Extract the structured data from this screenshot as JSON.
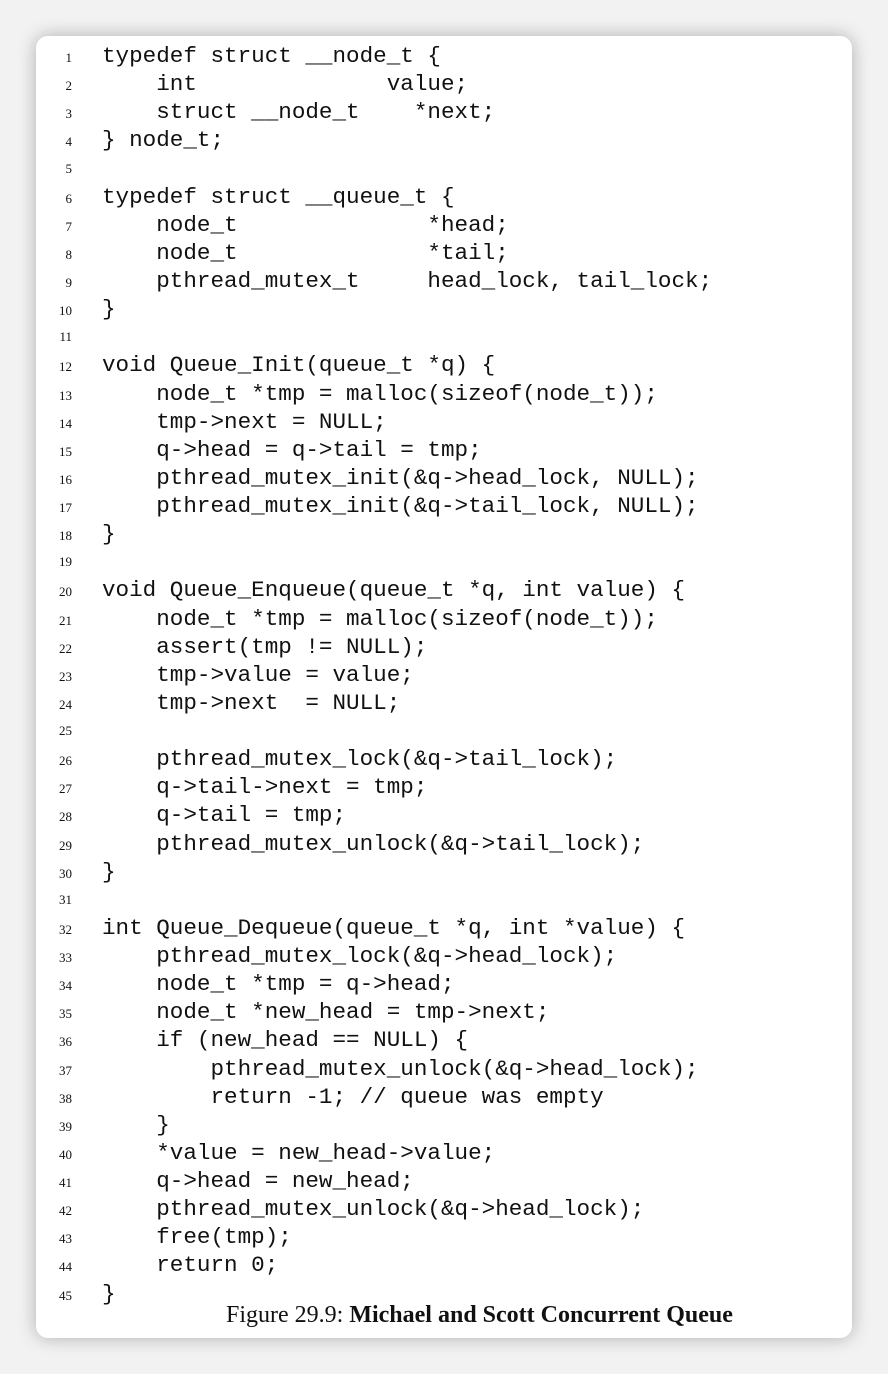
{
  "code_lines": [
    {
      "number": "1",
      "code": "typedef struct __node_t {"
    },
    {
      "number": "2",
      "code": "    int              value;"
    },
    {
      "number": "3",
      "code": "    struct __node_t    *next;"
    },
    {
      "number": "4",
      "code": "} node_t;"
    },
    {
      "number": "5",
      "code": ""
    },
    {
      "number": "6",
      "code": "typedef struct __queue_t {"
    },
    {
      "number": "7",
      "code": "    node_t              *head;"
    },
    {
      "number": "8",
      "code": "    node_t              *tail;"
    },
    {
      "number": "9",
      "code": "    pthread_mutex_t     head_lock, tail_lock;"
    },
    {
      "number": "10",
      "code": "}"
    },
    {
      "number": "11",
      "code": ""
    },
    {
      "number": "12",
      "code": "void Queue_Init(queue_t *q) {"
    },
    {
      "number": "13",
      "code": "    node_t *tmp = malloc(sizeof(node_t));"
    },
    {
      "number": "14",
      "code": "    tmp->next = NULL;"
    },
    {
      "number": "15",
      "code": "    q->head = q->tail = tmp;"
    },
    {
      "number": "16",
      "code": "    pthread_mutex_init(&q->head_lock, NULL);"
    },
    {
      "number": "17",
      "code": "    pthread_mutex_init(&q->tail_lock, NULL);"
    },
    {
      "number": "18",
      "code": "}"
    },
    {
      "number": "19",
      "code": ""
    },
    {
      "number": "20",
      "code": "void Queue_Enqueue(queue_t *q, int value) {"
    },
    {
      "number": "21",
      "code": "    node_t *tmp = malloc(sizeof(node_t));"
    },
    {
      "number": "22",
      "code": "    assert(tmp != NULL);"
    },
    {
      "number": "23",
      "code": "    tmp->value = value;"
    },
    {
      "number": "24",
      "code": "    tmp->next  = NULL;"
    },
    {
      "number": "25",
      "code": ""
    },
    {
      "number": "26",
      "code": "    pthread_mutex_lock(&q->tail_lock);"
    },
    {
      "number": "27",
      "code": "    q->tail->next = tmp;"
    },
    {
      "number": "28",
      "code": "    q->tail = tmp;"
    },
    {
      "number": "29",
      "code": "    pthread_mutex_unlock(&q->tail_lock);"
    },
    {
      "number": "30",
      "code": "}"
    },
    {
      "number": "31",
      "code": ""
    },
    {
      "number": "32",
      "code": "int Queue_Dequeue(queue_t *q, int *value) {"
    },
    {
      "number": "33",
      "code": "    pthread_mutex_lock(&q->head_lock);"
    },
    {
      "number": "34",
      "code": "    node_t *tmp = q->head;"
    },
    {
      "number": "35",
      "code": "    node_t *new_head = tmp->next;"
    },
    {
      "number": "36",
      "code": "    if (new_head == NULL) {"
    },
    {
      "number": "37",
      "code": "        pthread_mutex_unlock(&q->head_lock);"
    },
    {
      "number": "38",
      "code": "        return -1; // queue was empty"
    },
    {
      "number": "39",
      "code": "    }"
    },
    {
      "number": "40",
      "code": "    *value = new_head->value;"
    },
    {
      "number": "41",
      "code": "    q->head = new_head;"
    },
    {
      "number": "42",
      "code": "    pthread_mutex_unlock(&q->head_lock);"
    },
    {
      "number": "43",
      "code": "    free(tmp);"
    },
    {
      "number": "44",
      "code": "    return 0;"
    },
    {
      "number": "45",
      "code": "}"
    }
  ],
  "caption": {
    "label": "Figure 29.9: ",
    "title": "Michael and Scott Concurrent Queue"
  }
}
